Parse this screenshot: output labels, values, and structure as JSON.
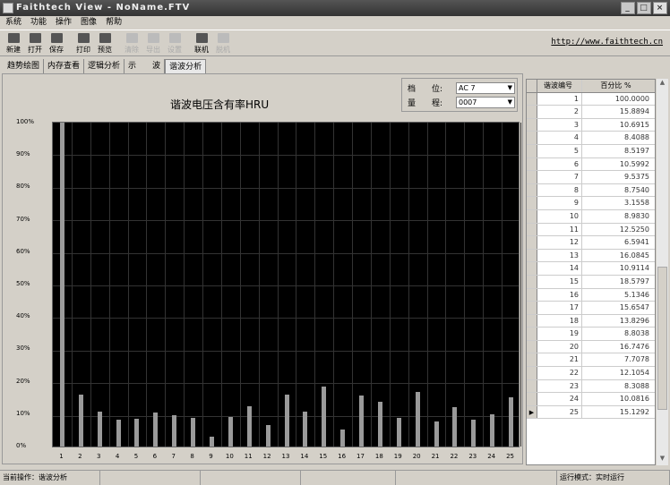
{
  "window": {
    "title": "Faithtech View - NoName.FTV"
  },
  "menu": [
    "系统",
    "功能",
    "操作",
    "图像",
    "帮助"
  ],
  "toolbar": [
    {
      "label": "新建",
      "enabled": true
    },
    {
      "label": "打开",
      "enabled": true
    },
    {
      "label": "保存",
      "enabled": true
    },
    {
      "label": "打印",
      "enabled": true
    },
    {
      "label": "预览",
      "enabled": true
    },
    {
      "label": "清除",
      "enabled": false
    },
    {
      "label": "导出",
      "enabled": false
    },
    {
      "label": "设置",
      "enabled": false
    },
    {
      "label": "联机",
      "enabled": true
    },
    {
      "label": "脱机",
      "enabled": false
    }
  ],
  "url": "http://www.faithtech.cn",
  "tabs": [
    "趋势绘图",
    "内存查看",
    "逻辑分析",
    "示　　波",
    "谐波分析"
  ],
  "selectors": {
    "range_label": "档　　位:",
    "range_value": "AC 7",
    "scale_label": "量　　程:",
    "scale_value": "0007"
  },
  "chart_data": {
    "type": "bar",
    "title": "谐波电压含有率HRU",
    "xlabel": "",
    "ylabel": "",
    "ylim": [
      0,
      100
    ],
    "yticks": [
      "100%",
      "90%",
      "80%",
      "70%",
      "60%",
      "50%",
      "40%",
      "30%",
      "20%",
      "10%",
      "0%"
    ],
    "categories": [
      "1",
      "2",
      "3",
      "4",
      "5",
      "6",
      "7",
      "8",
      "9",
      "10",
      "11",
      "12",
      "13",
      "14",
      "15",
      "16",
      "17",
      "18",
      "19",
      "20",
      "21",
      "22",
      "23",
      "24",
      "25"
    ],
    "values": [
      100.0,
      15.8894,
      10.6915,
      8.4088,
      8.5197,
      10.5992,
      9.5375,
      8.754,
      3.1558,
      8.983,
      12.525,
      6.5941,
      16.0845,
      10.9114,
      18.5797,
      5.1346,
      15.6547,
      13.8296,
      8.8038,
      16.7476,
      7.7078,
      12.1054,
      8.3088,
      10.0816,
      15.1292
    ]
  },
  "table": {
    "headers": [
      "谐波编号",
      "百分比 %"
    ],
    "rows": [
      [
        "1",
        "100.0000"
      ],
      [
        "2",
        "15.8894"
      ],
      [
        "3",
        "10.6915"
      ],
      [
        "4",
        "8.4088"
      ],
      [
        "5",
        "8.5197"
      ],
      [
        "6",
        "10.5992"
      ],
      [
        "7",
        "9.5375"
      ],
      [
        "8",
        "8.7540"
      ],
      [
        "9",
        "3.1558"
      ],
      [
        "10",
        "8.9830"
      ],
      [
        "11",
        "12.5250"
      ],
      [
        "12",
        "6.5941"
      ],
      [
        "13",
        "16.0845"
      ],
      [
        "14",
        "10.9114"
      ],
      [
        "15",
        "18.5797"
      ],
      [
        "16",
        "5.1346"
      ],
      [
        "17",
        "15.6547"
      ],
      [
        "18",
        "13.8296"
      ],
      [
        "19",
        "8.8038"
      ],
      [
        "20",
        "16.7476"
      ],
      [
        "21",
        "7.7078"
      ],
      [
        "22",
        "12.1054"
      ],
      [
        "23",
        "8.3088"
      ],
      [
        "24",
        "10.0816"
      ],
      [
        "25",
        "15.1292"
      ]
    ]
  },
  "status": {
    "current_op": "当前操作：谐波分析",
    "run_mode": "运行模式：实时运行"
  }
}
